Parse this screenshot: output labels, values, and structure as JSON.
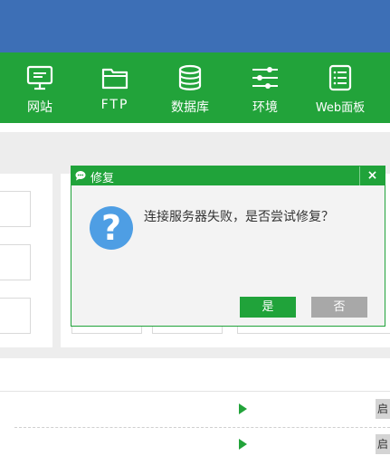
{
  "toolbar": {
    "items": [
      {
        "label": "网站",
        "icon": "monitor-icon"
      },
      {
        "label": "FTP",
        "icon": "folder-icon"
      },
      {
        "label": "数据库",
        "icon": "database-icon"
      },
      {
        "label": "环境",
        "icon": "sliders-icon"
      },
      {
        "label": "Web面板",
        "icon": "list-panel-icon"
      }
    ]
  },
  "list": {
    "rows": [
      {
        "action_icon": "play-icon",
        "button_label": "启"
      },
      {
        "action_icon": "play-icon",
        "button_label": "启"
      }
    ]
  },
  "dialog": {
    "title": "修复",
    "close_label": "×",
    "icon": "question-icon",
    "icon_glyph": "?",
    "message": "连接服务器失败，是否尝试修复？",
    "yes_label": "是",
    "no_label": "否"
  },
  "colors": {
    "top_bar": "#3d6fb6",
    "toolbar": "#22a33a",
    "dialog_accent": "#20a33a",
    "question_icon": "#4e9ee4",
    "no_button": "#a8a8a8"
  }
}
